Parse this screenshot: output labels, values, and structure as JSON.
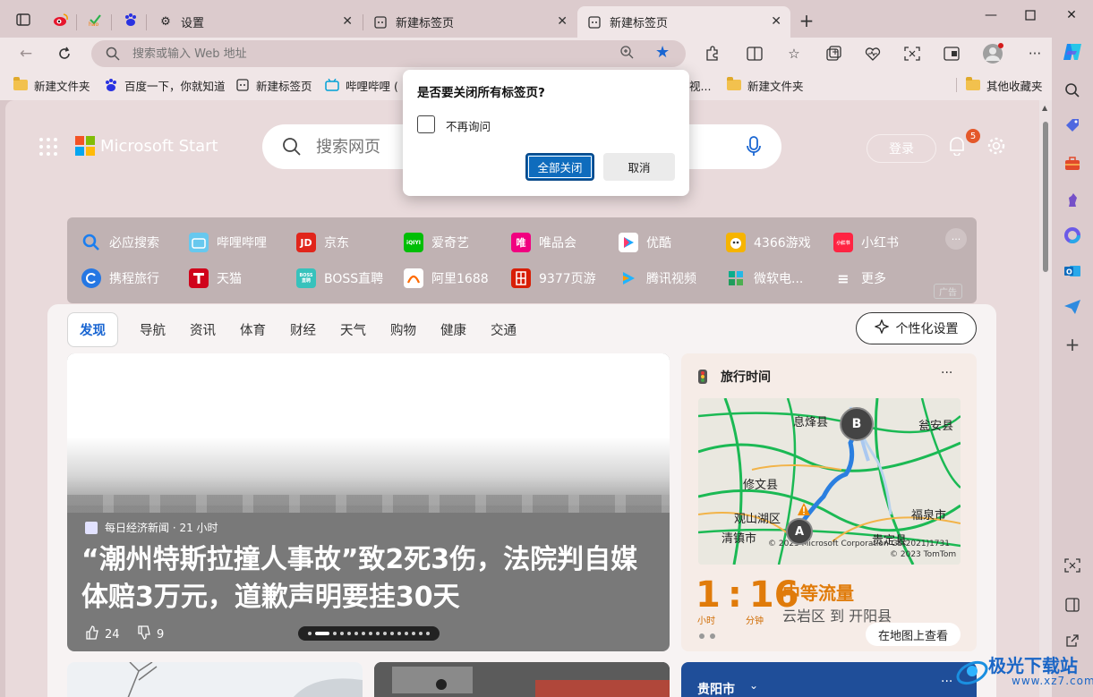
{
  "tabs": [
    {
      "label": "设置",
      "icon": "gear-icon"
    },
    {
      "label": "新建标签页",
      "icon": "newtab-icon"
    },
    {
      "label": "新建标签页",
      "icon": "newtab-icon",
      "active": true
    }
  ],
  "address_bar": {
    "placeholder": "搜索或输入 Web 地址"
  },
  "favorites": [
    {
      "label": "新建文件夹",
      "icon": "folder-icon"
    },
    {
      "label": "百度一下，你就知道",
      "icon": "baidu-icon"
    },
    {
      "label": "新建标签页",
      "icon": "newtab-icon"
    },
    {
      "label": "哔哩哔哩 (",
      "icon": "bilibili-icon"
    },
    {
      "label": "视...",
      "icon": ""
    },
    {
      "label": "新建文件夹",
      "icon": "folder-icon"
    },
    {
      "label": "其他收藏夹",
      "icon": "folder-icon"
    }
  ],
  "newtab": {
    "brand": "Microsoft Start",
    "search_placeholder": "搜索网页",
    "login": "登录",
    "notification_count": "5",
    "quick_links_row1": [
      "必应搜索",
      "哔哩哔哩",
      "京东",
      "爱奇艺",
      "唯品会",
      "优酷",
      "4366游戏",
      "小红书"
    ],
    "quick_links_row2": [
      "携程旅行",
      "天猫",
      "BOSS直聘",
      "阿里1688",
      "9377页游",
      "腾讯视频",
      "微软电...",
      "更多"
    ],
    "quick_links_row1_icons": [
      "Q",
      "▣",
      "JD",
      "iQ",
      "唯",
      "▶",
      "◉",
      "书"
    ],
    "quick_links_row2_icons": [
      "C",
      "T",
      "B",
      "@",
      "R",
      "▶",
      "◆",
      "≡"
    ],
    "ad_label": "广告",
    "quicklink_icons": [
      "▣",
      "▣",
      "JD"
    ],
    "jd_icon": "JD",
    "iqiyi_icon": "iQIYI",
    "vip_icon": "唯",
    "boss_icon": "BOSS\n直聘",
    "nine_icon": "R",
    "xhs_icon": "小红书"
  },
  "feed": {
    "nav": [
      "发现",
      "导航",
      "资讯",
      "体育",
      "财经",
      "天气",
      "购物",
      "健康",
      "交通"
    ],
    "personalize": "个性化设置",
    "hero": {
      "source": "每日经济新闻 · 21 小时",
      "headline": "“潮州特斯拉撞人事故”致2死3伤，法院判自媒体赔3万元，道歉声明要挂30天",
      "likes": "24",
      "dislikes": "9"
    },
    "travel": {
      "title": "旅行时间",
      "hours": "1",
      "hours_unit": "小时",
      "minutes": "16",
      "minutes_unit": "分钟",
      "traffic": "中等流量",
      "route": "云岩区 到 开阳县",
      "view_map": "在地图上查看",
      "map_labels": {
        "xifeng": "息烽县",
        "wengan": "瓮安县",
        "xiuwen": "修文县",
        "guanshan": "观山湖区",
        "qingzhen": "清镇市",
        "fuquan": "福泉市",
        "guiding": "贵定县",
        "copyright1": "© 2023 Microsoft Corporation GS(2021)1731",
        "copyright2": "© 2023 TomTom",
        "pin_a": "A",
        "pin_b": "B"
      }
    },
    "weather_city": "贵阳市"
  },
  "dialog": {
    "title": "是否要关闭所有标签页?",
    "checkbox_label": "不再询问",
    "primary": "全部关闭",
    "secondary": "取消"
  },
  "watermark": {
    "brand": "极光下载站",
    "url": "www.xz7.com"
  }
}
